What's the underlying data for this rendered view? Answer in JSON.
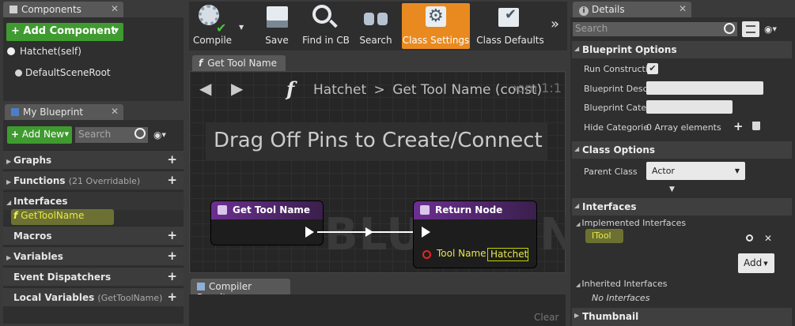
{
  "components": {
    "tab_label": "Components",
    "add_button": "+ Add Component",
    "items": [
      "Hatchet(self)",
      "DefaultSceneRoot"
    ]
  },
  "my_blueprint": {
    "tab_label": "My Blueprint",
    "add_new": "Add New",
    "search_placeholder": "Search",
    "sections": {
      "graphs": "Graphs",
      "functions": "Functions",
      "functions_sub": "(21 Overridable)",
      "interfaces": "Interfaces",
      "interface_item": "GetToolName",
      "macros": "Macros",
      "variables": "Variables",
      "event_dispatchers": "Event Dispatchers",
      "local_variables": "Local Variables",
      "local_variables_sub": "(GetToolName)"
    }
  },
  "toolbar": {
    "compile": "Compile",
    "save": "Save",
    "find_in_cb": "Find in CB",
    "search": "Search",
    "class_settings": "Class Settings",
    "class_defaults": "Class Defaults",
    "overflow": "»"
  },
  "graph": {
    "tab_label": "Get Tool Name",
    "breadcrumb_root": "Hatchet",
    "breadcrumb_sep": ">",
    "breadcrumb_current": "Get Tool Name (const)",
    "zoom": "Zoom 1:1",
    "hint": "Drag Off Pins to Create/Connect",
    "watermark": "BLUEPRINT",
    "entry_node": "Get Tool Name",
    "return_node": "Return Node",
    "return_pin": "Tool Name",
    "return_pin_value": "Hatchet"
  },
  "compiler": {
    "tab_label": "Compiler Results",
    "clear": "Clear"
  },
  "details": {
    "tab_label": "Details",
    "search_placeholder": "Search",
    "blueprint_options": "Blueprint Options",
    "run_construction": "Run Constructi",
    "blueprint_desc": "Blueprint Desc",
    "blueprint_cate": "Blueprint Cate",
    "hide_categories": "Hide Categorie",
    "array_elements": "0 Array elements",
    "class_options": "Class Options",
    "parent_class": "Parent Class",
    "parent_value": "Actor",
    "interfaces": "Interfaces",
    "implemented": "Implemented Interfaces",
    "itool": "ITool",
    "add": "Add",
    "inherited": "Inherited Interfaces",
    "no_interfaces": "No Interfaces",
    "thumbnail": "Thumbnail"
  },
  "colors": {
    "accent_green": "#3f9b2f",
    "active_orange": "#f08a1c",
    "node_purple": "#5c2d7a",
    "highlight": "#c3d400"
  }
}
